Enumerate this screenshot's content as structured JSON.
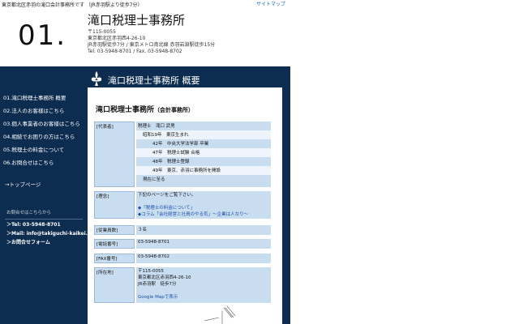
{
  "header": {
    "tagline": "東京都北区赤羽の滝口会計事務所です （JR赤羽駅より徒歩7分）",
    "sitemap": "サイトマップ",
    "page_number": "01.",
    "firm_name": "滝口税理士事務所",
    "address_lines": [
      "〒115-0055",
      "東京都北区赤羽西4-26-10",
      "JR赤羽駅徒歩7分 / 東京メトロ南北線 赤羽岩淵駅徒歩15分",
      "Tel. 03-5948-8701 / Fax. 03-5948-8702"
    ]
  },
  "sidebar": {
    "items": [
      {
        "label": "01.滝口税理士事務所 概要"
      },
      {
        "label": "02.法人のお客様はこちら"
      },
      {
        "label": "03.個人事業者のお客様はこちら"
      },
      {
        "label": "04.相続でお困りの方はこちら"
      },
      {
        "label": "05.税理士の料金について"
      },
      {
        "label": "06.お問合せはこちら"
      }
    ],
    "top_link": "→トップページ",
    "contact_title": "お問合せはこちらから",
    "contacts": [
      "＞Tel: 03-5948-8701",
      "＞Mail: info@takiguchi-kaikei.jp",
      "＞お問合せフォーム"
    ]
  },
  "main": {
    "header_title": "滝口税理士事務所 概要",
    "section_title": "滝口税理士事務所",
    "section_subtitle": "（会計事務所）",
    "rows": {
      "rep_label": "[代表者]",
      "rep_lines": [
        "税理士　滝口 武男",
        "昭和19年　東京生まれ",
        "42年　中央大学法学部 卒業",
        "47年　税理士試験 合格",
        "48年　税理士登録",
        "49年　東京、赤羽に事務所を開設",
        "現在に至る"
      ],
      "philo_label": "[理念]",
      "philo_lines": [
        "下記のページをご覧下さい。",
        "◆「税理士の料金について」",
        "◆コラム「会社経営と社員のやる気」～企業は人なり～"
      ],
      "staff_label": "[従業員数]",
      "staff_value": "３名",
      "tel_label": "[電話番号]",
      "tel_value": "03-5948-8701",
      "fax_label": "[FAX番号]",
      "fax_value": "03-5948-8702",
      "loc_label": "[所在地]",
      "loc_lines": [
        "〒115-0055",
        "東京都北区赤羽西4-26-10",
        "JR赤羽駅　徒歩7分"
      ],
      "map_link": "Google Mapで表示"
    }
  },
  "colors": {
    "navy": "#0d2d50",
    "cell_blue": "#c9ddf1",
    "link_blue": "#1a4fa8"
  }
}
